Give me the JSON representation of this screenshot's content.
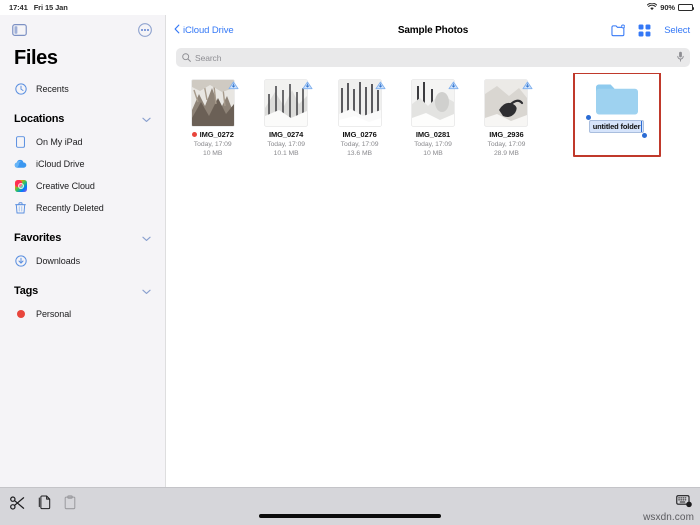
{
  "status_bar": {
    "time": "17:41",
    "date": "Fri 15 Jan",
    "battery_percent": "90%",
    "wifi_icon": "wifi-icon",
    "battery_icon": "battery-icon",
    "battery_level": 90
  },
  "sidebar": {
    "toggle_icon": "sidebar-toggle-icon",
    "more_icon": "more-ellipsis-icon",
    "title": "Files",
    "recents": {
      "label": "Recents",
      "icon": "clock-icon"
    },
    "groups": [
      {
        "title": "Locations",
        "chevron": "chevron-down-icon",
        "items": [
          {
            "label": "On My iPad",
            "icon": "ipad-icon"
          },
          {
            "label": "iCloud Drive",
            "icon": "cloud-icon"
          },
          {
            "label": "Creative Cloud",
            "icon": "creative-cloud-icon"
          },
          {
            "label": "Recently Deleted",
            "icon": "trash-icon"
          }
        ]
      },
      {
        "title": "Favorites",
        "chevron": "chevron-down-icon",
        "items": [
          {
            "label": "Downloads",
            "icon": "download-circle-icon"
          }
        ]
      },
      {
        "title": "Tags",
        "chevron": "chevron-down-icon",
        "items": [
          {
            "label": "Personal",
            "icon": "tag-dot-icon",
            "color": "#e8453c"
          }
        ]
      }
    ]
  },
  "navbar": {
    "back_label": "iCloud Drive",
    "back_icon": "chevron-left-icon",
    "title": "Sample Photos",
    "new_folder_icon": "new-folder-icon",
    "grid_view_icon": "grid-view-icon",
    "select_label": "Select"
  },
  "search": {
    "placeholder": "Search",
    "value": "",
    "search_icon": "search-icon",
    "mic_icon": "microphone-icon"
  },
  "files": [
    {
      "name": "IMG_0272",
      "date": "Today, 17:09",
      "size": "10 MB",
      "tag_color": "#e8453c",
      "cloud_badge": "icloud-download-icon"
    },
    {
      "name": "IMG_0274",
      "date": "Today, 17:09",
      "size": "10.1 MB",
      "tag_color": "",
      "cloud_badge": "icloud-download-icon"
    },
    {
      "name": "IMG_0276",
      "date": "Today, 17:09",
      "size": "13.6 MB",
      "tag_color": "",
      "cloud_badge": "icloud-download-icon"
    },
    {
      "name": "IMG_0281",
      "date": "Today, 17:09",
      "size": "10 MB",
      "tag_color": "",
      "cloud_badge": "icloud-download-icon"
    },
    {
      "name": "IMG_2936",
      "date": "Today, 17:09",
      "size": "28.9 MB",
      "tag_color": "",
      "cloud_badge": "icloud-download-icon"
    }
  ],
  "new_folder": {
    "icon": "folder-icon",
    "name_value": "untitled folder",
    "highlight_color": "#c0392b",
    "selected": true
  },
  "bottom_bar": {
    "cut_icon": "scissors-cut-icon",
    "copy_icon": "copy-icon",
    "paste_icon": "paste-icon",
    "keyboard_dismiss_icon": "keyboard-dismiss-icon",
    "home_indicator": "home-indicator",
    "watermark": "wsxdn.com"
  }
}
